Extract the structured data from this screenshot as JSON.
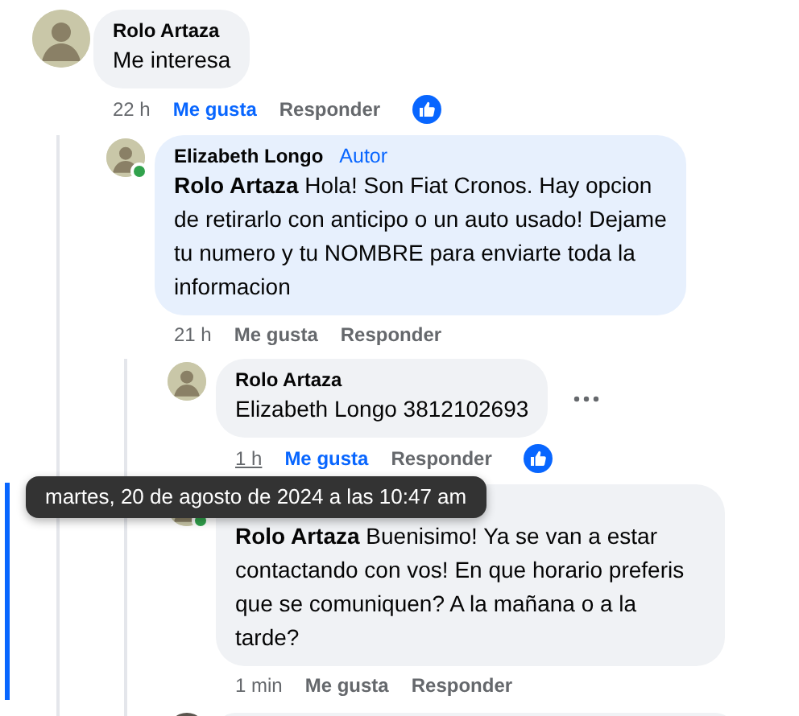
{
  "comments": [
    {
      "kind": "comment",
      "author": "Rolo Artaza",
      "text": "Me interesa",
      "time": "22 h",
      "time_hovered": false,
      "like": "Me gusta",
      "reply": "Responder",
      "liked": true,
      "online": false,
      "menu": false,
      "children": [
        {
          "kind": "comment",
          "author": "Elizabeth Longo",
          "badge": "Autor",
          "text": "**Rolo Artaza** Hola! Son Fiat Cronos. Hay opcion de retirarlo con anticipo o un auto usado! Dejame tu numero y tu NOMBRE para enviarte toda la informacion",
          "time": "21 h",
          "time_hovered": false,
          "like": "Me gusta",
          "reply": "Responder",
          "liked": false,
          "online": true,
          "menu": false,
          "children": [
            {
              "kind": "comment",
              "author": "Rolo Artaza",
              "text": "Elizabeth Longo 3812102693",
              "time": "1 h",
              "time_hovered": true,
              "like": "Me gusta",
              "reply": "Responder",
              "liked": true,
              "online": false,
              "menu": true
            },
            {
              "kind": "comment",
              "text": "**Rolo Artaza** Buenisimo! Ya se van a estar contactando con vos! En que horario preferis que se comuniquen? A la mañana o a la tarde?",
              "time": "1 min",
              "time_hovered": false,
              "like": "Me gusta",
              "reply": "Responder",
              "liked": false,
              "online": true,
              "menu": false
            },
            {
              "kind": "partial"
            }
          ]
        }
      ]
    }
  ],
  "tooltip": "martes, 20 de agosto de 2024 a las 10:47 am"
}
